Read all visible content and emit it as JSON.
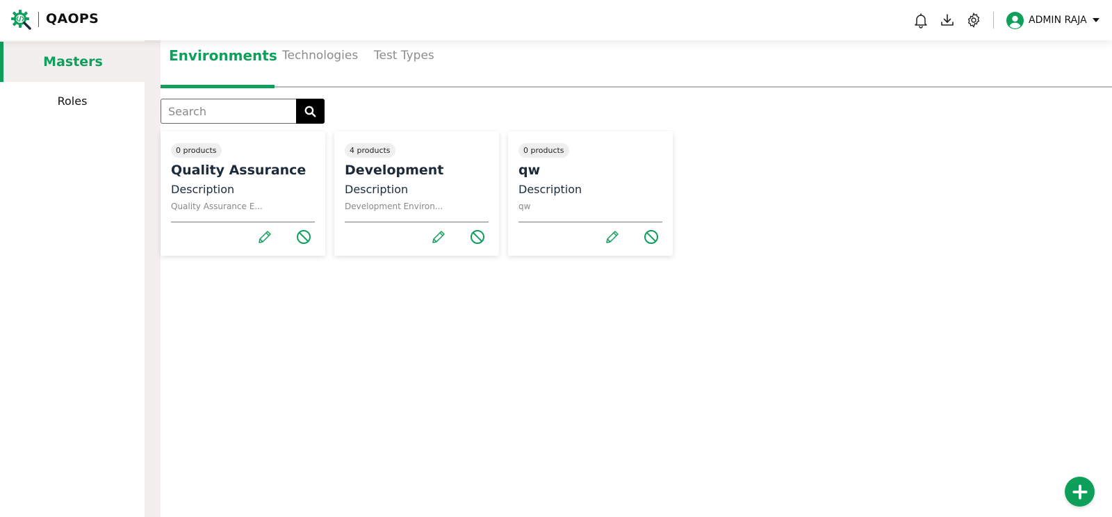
{
  "header": {
    "app_name": "QAOPS",
    "icons": [
      "logo-gear-code-icon",
      "bell-icon",
      "download-icon",
      "settings-icon",
      "user-avatar-icon",
      "caret-down-icon"
    ],
    "user_name": "ADMIN RAJA"
  },
  "sidebar": {
    "items": [
      {
        "label": "Masters",
        "active": true
      },
      {
        "label": "Roles",
        "active": false
      }
    ]
  },
  "tabs": [
    {
      "label": "Environments",
      "active": true
    },
    {
      "label": "Technologies",
      "active": false
    },
    {
      "label": "Test Types",
      "active": false
    }
  ],
  "search": {
    "placeholder": "Search",
    "value": ""
  },
  "cards": [
    {
      "badge": "0 products",
      "title": "Quality Assurance",
      "description_label": "Description",
      "description": "Quality Assurance E..."
    },
    {
      "badge": "4 products",
      "title": "Development",
      "description_label": "Description",
      "description": "Development Environ..."
    },
    {
      "badge": "0 products",
      "title": "qw",
      "description_label": "Description",
      "description": "qw"
    }
  ],
  "colors": {
    "accent": "#0e9f5b",
    "sidebar_bg": "#f3efee",
    "text_dark": "#1c2a3a",
    "text_muted": "#8c8c8c"
  }
}
